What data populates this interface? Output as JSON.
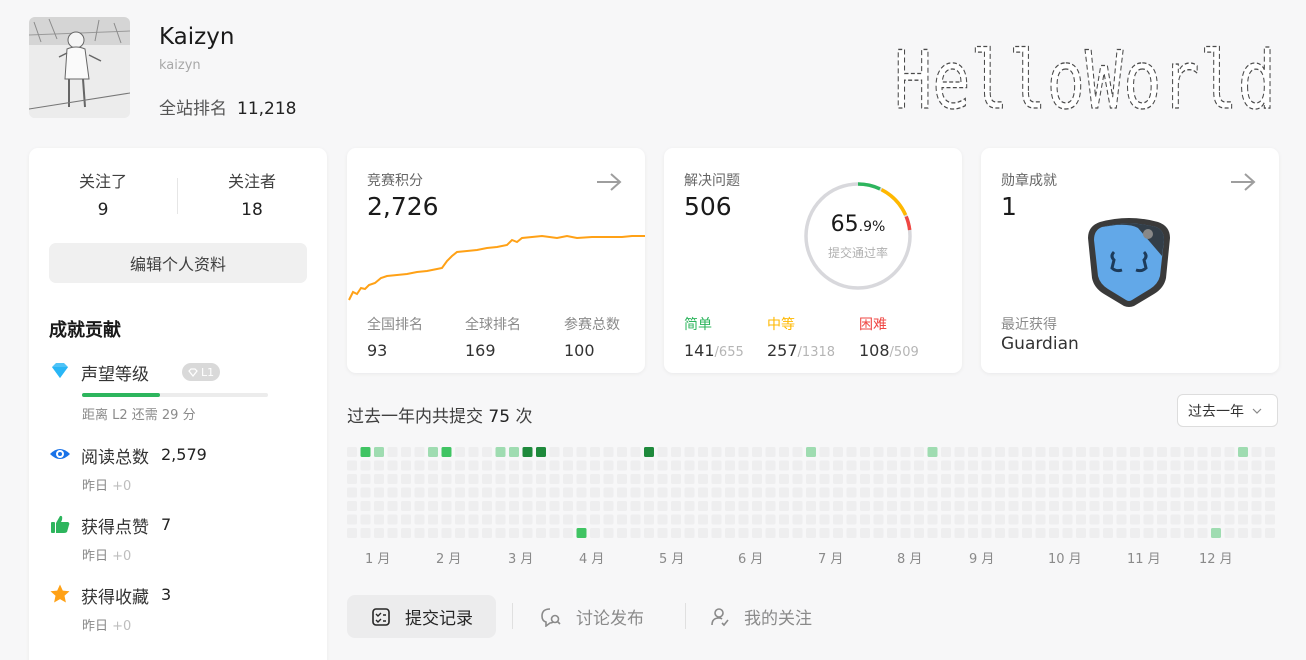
{
  "profile": {
    "display_name": "Kaizyn",
    "username": "kaizyn",
    "rank_label": "全站排名",
    "rank_value": "11,218"
  },
  "sidebar": {
    "following_label": "关注了",
    "following_count": "9",
    "followers_label": "关注者",
    "followers_count": "18",
    "edit_button": "编辑个人资料",
    "achievements_heading": "成就贡献",
    "stats": [
      {
        "name": "声望等级",
        "badge": "L1",
        "sub": "距离 L2 还需 29 分",
        "progress": 0.42,
        "icon": "diamond-icon"
      },
      {
        "name": "阅读总数",
        "value": "2,579",
        "sub": "昨日",
        "inc": "+0",
        "icon": "eye-icon"
      },
      {
        "name": "获得点赞",
        "value": "7",
        "sub": "昨日",
        "inc": "+0",
        "icon": "thumbs-up-icon"
      },
      {
        "name": "获得收藏",
        "value": "3",
        "sub": "昨日",
        "inc": "+0",
        "icon": "star-icon"
      }
    ]
  },
  "contest": {
    "label": "竞赛积分",
    "rating": "2,726",
    "national_rank_label": "全国排名",
    "national_rank": "93",
    "global_rank_label": "全球排名",
    "global_rank": "169",
    "attended_label": "参赛总数",
    "attended": "100"
  },
  "solved": {
    "label": "解决问题",
    "total": "506",
    "acceptance_int": "65",
    "acceptance_dec": ".9%",
    "acceptance_label": "提交通过率",
    "easy_label": "简单",
    "easy": "141",
    "easy_total": "/655",
    "medium_label": "中等",
    "medium": "257",
    "medium_total": "/1318",
    "hard_label": "困难",
    "hard": "108",
    "hard_total": "/509",
    "colors": {
      "easy": "#2db55d",
      "medium": "#ffb800",
      "hard": "#ef4743"
    }
  },
  "badges": {
    "label": "勋章成就",
    "count": "1",
    "recent_label": "最近获得",
    "recent_name": "Guardian"
  },
  "heatmap": {
    "summary_prefix": "过去一年内共提交",
    "summary_count": "75",
    "summary_suffix": "次",
    "range": "过去一年",
    "months": [
      "1 月",
      "2 月",
      "3 月",
      "4 月",
      "5 月",
      "6 月",
      "7 月",
      "8 月",
      "9 月",
      "10 月",
      "11 月",
      "12 月"
    ]
  },
  "tabs": {
    "submissions": "提交记录",
    "discussions": "讨论发布",
    "following": "我的关注"
  },
  "banner_text": "HelloWorld"
}
